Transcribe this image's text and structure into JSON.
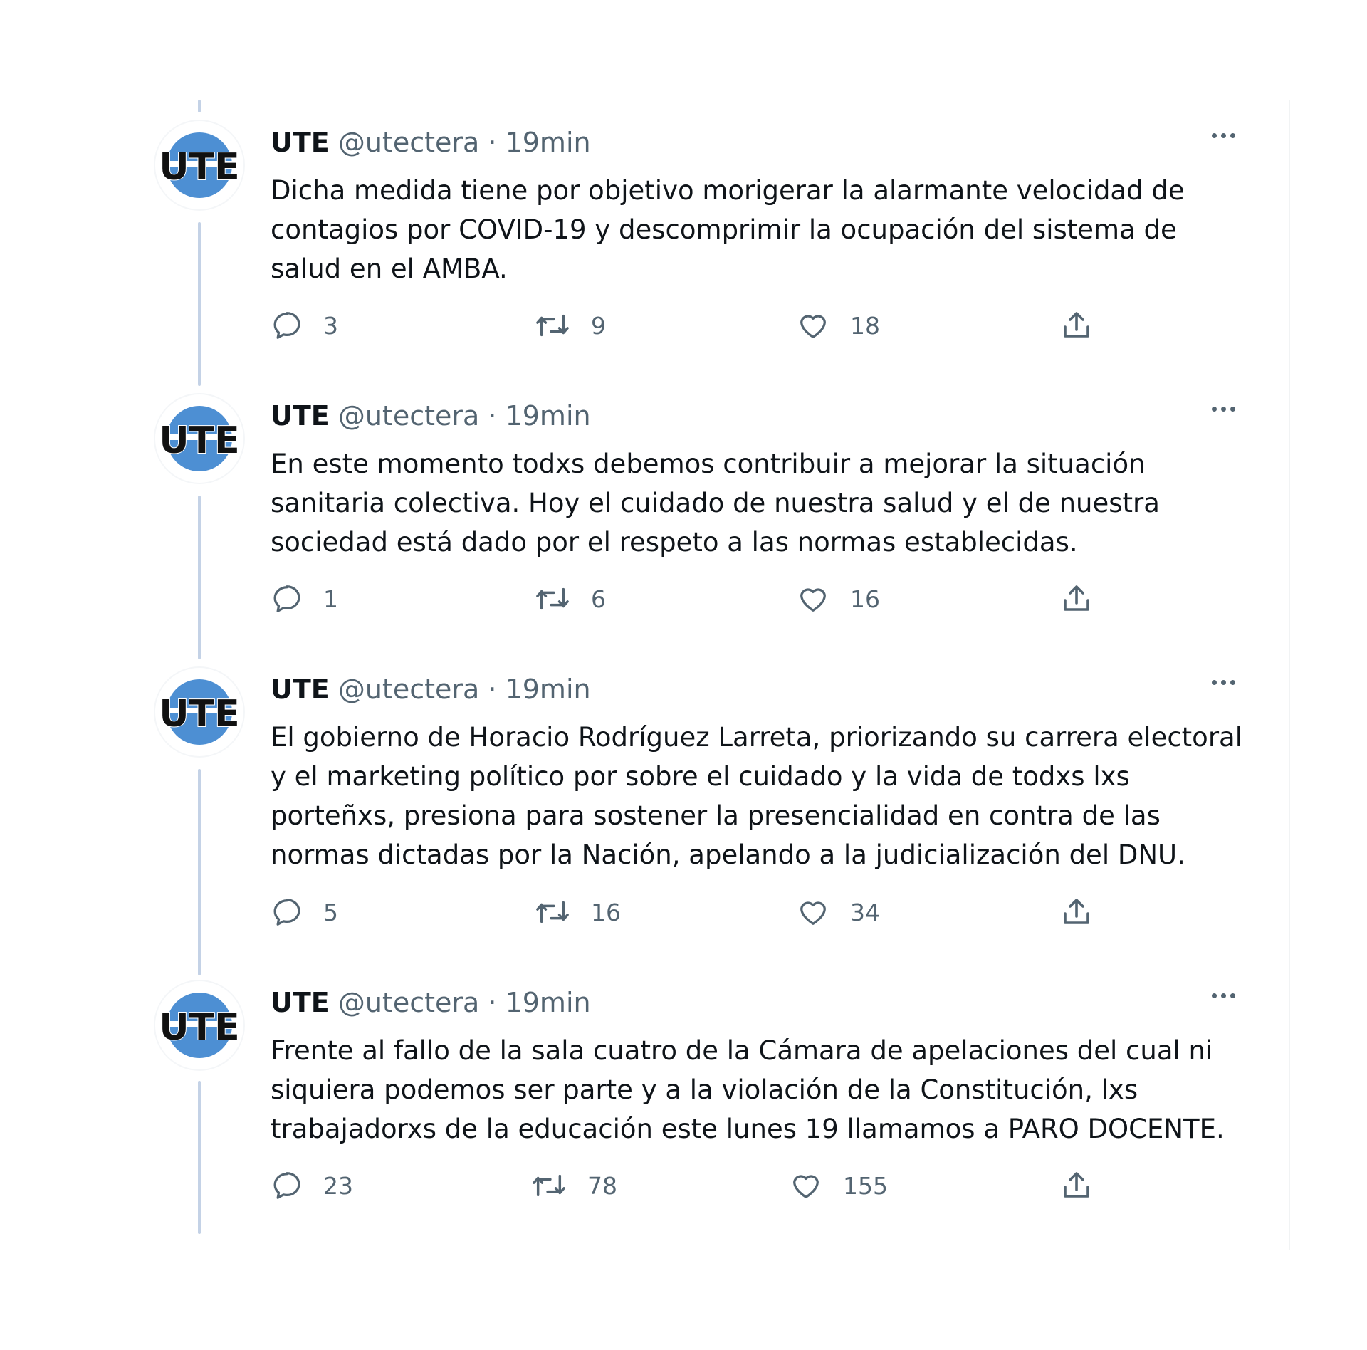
{
  "colors": {
    "thread_line": "#c4d2e6",
    "avatar_blue": "#4d8fd3",
    "secondary_text": "#536471",
    "primary_text": "#0f1419"
  },
  "icons": {
    "reply": "reply-icon",
    "retweet": "retweet-icon",
    "like": "heart-icon",
    "share": "share-icon",
    "more": "more-icon"
  },
  "tweets": [
    {
      "avatar_text": "UTE",
      "name": "UTE",
      "handle": "@utectera",
      "separator": "·",
      "time": "19min",
      "text": "Dicha medida tiene por objetivo morigerar la alarmante velocidad de contagios por COVID-19 y descomprimir la ocupación del sistema de salud en el AMBA.",
      "replies": "3",
      "retweets": "9",
      "likes": "18"
    },
    {
      "avatar_text": "UTE",
      "name": "UTE",
      "handle": "@utectera",
      "separator": "·",
      "time": "19min",
      "text": "En este momento todxs debemos contribuir a mejorar la situación sanitaria colectiva. Hoy el cuidado de nuestra salud y el de nuestra sociedad está dado por el respeto a las normas establecidas.",
      "replies": "1",
      "retweets": "6",
      "likes": "16"
    },
    {
      "avatar_text": "UTE",
      "name": "UTE",
      "handle": "@utectera",
      "separator": "·",
      "time": "19min",
      "text": "El gobierno de Horacio Rodríguez Larreta, priorizando su carrera electoral y el marketing político por sobre el cuidado y la vida de todxs lxs porteñxs, presiona para sostener la presencialidad en contra de las normas dictadas por la Nación, apelando a la judicialización del DNU.",
      "replies": "5",
      "retweets": "16",
      "likes": "34"
    },
    {
      "avatar_text": "UTE",
      "name": "UTE",
      "handle": "@utectera",
      "separator": "·",
      "time": "19min",
      "text": "Frente al fallo de la sala cuatro de la Cámara de apelaciones del cual ni siquiera podemos ser parte y a la violación de la Constitución, lxs trabajadorxs de la educación este lunes 19 llamamos a PARO DOCENTE.",
      "replies": "23",
      "retweets": "78",
      "likes": "155"
    }
  ]
}
